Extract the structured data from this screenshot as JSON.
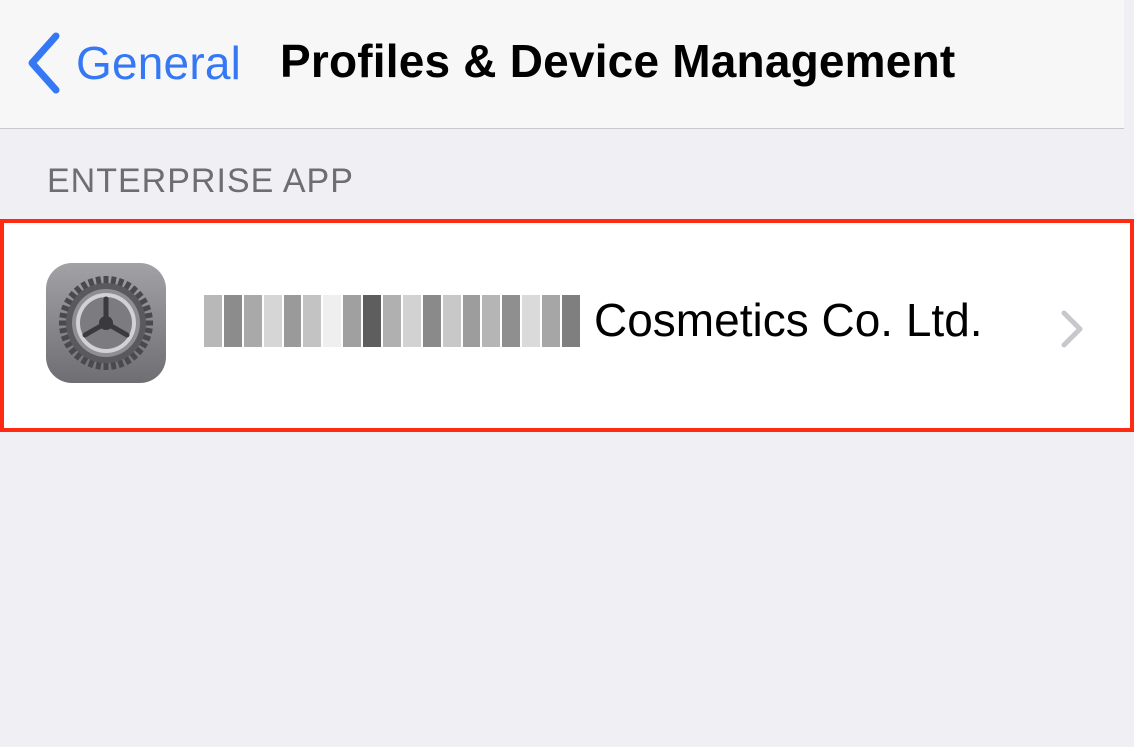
{
  "nav": {
    "back_label": "General",
    "title": "Profiles & Device Management"
  },
  "section": {
    "header": "ENTERPRISE APP"
  },
  "profile": {
    "name_suffix": "Cosmetics Co. Ltd.",
    "name_prefix_redacted": true
  },
  "colors": {
    "accent": "#3478f6",
    "highlight_border": "#ff2a12",
    "background": "#efeff4"
  },
  "icons": {
    "back": "chevron-left-icon",
    "app": "settings-gear-icon",
    "disclosure": "chevron-right-icon"
  }
}
